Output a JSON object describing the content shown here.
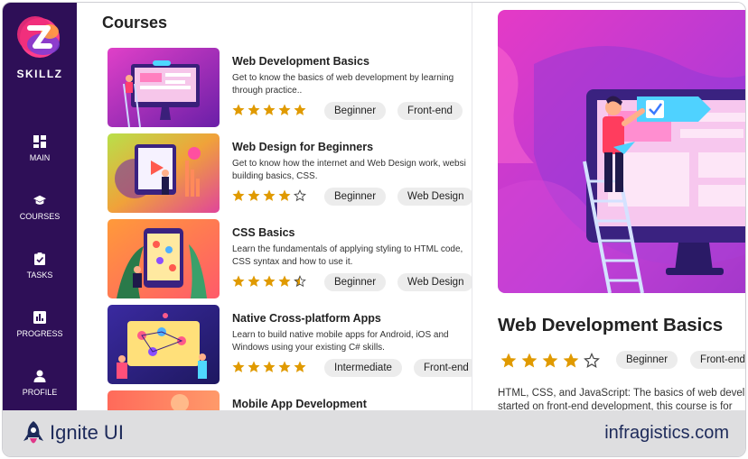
{
  "app": {
    "brand": "SKILLZ"
  },
  "sidebar": {
    "items": [
      {
        "label": "MAIN",
        "icon": "dashboard-icon"
      },
      {
        "label": "COURSES",
        "icon": "graduation-cap-icon"
      },
      {
        "label": "TASKS",
        "icon": "clipboard-check-icon"
      },
      {
        "label": "PROGRESS",
        "icon": "bar-chart-icon"
      },
      {
        "label": "PROFILE",
        "icon": "person-icon"
      }
    ]
  },
  "list": {
    "title": "Courses",
    "courses": [
      {
        "title": "Web Development Basics",
        "desc1": "Get to know the basics of web development by learning",
        "desc2": "through practice..",
        "rating": 5,
        "tags": [
          "Beginner",
          "Front-end"
        ]
      },
      {
        "title": "Web Design for Beginners",
        "desc1": "Get to know how the internet and Web Design work, websi",
        "desc2": "building basics, CSS.",
        "rating": 4,
        "tags": [
          "Beginner",
          "Web Design"
        ]
      },
      {
        "title": "CSS Basics",
        "desc1": "Learn the fundamentals of applying styling to HTML code,",
        "desc2": "CSS syntax and how to use it.",
        "rating": 4.5,
        "tags": [
          "Beginner",
          "Web Design"
        ]
      },
      {
        "title": "Native Cross-platform Apps",
        "desc1": "Learn to build native mobile apps for Android, iOS and",
        "desc2": "Windows using your existing C# skills.",
        "rating": 5,
        "tags": [
          "Intermediate",
          "Front-end"
        ]
      },
      {
        "title": "Mobile App Development",
        "desc1": "",
        "desc2": "",
        "rating": 0,
        "tags": []
      }
    ]
  },
  "detail": {
    "title": "Web Development Basics",
    "rating": 4,
    "tags": [
      "Beginner",
      "Front-end"
    ],
    "desc1": "HTML, CSS, and JavaScript: The basics of web devel",
    "desc2": "started on front-end development, this course is for"
  },
  "footer": {
    "brand": "Ignite UI",
    "site": "infragistics.com"
  },
  "colors": {
    "sidebar": "#2e0f57",
    "star": "#e09a00",
    "accent": "#e0388a"
  }
}
